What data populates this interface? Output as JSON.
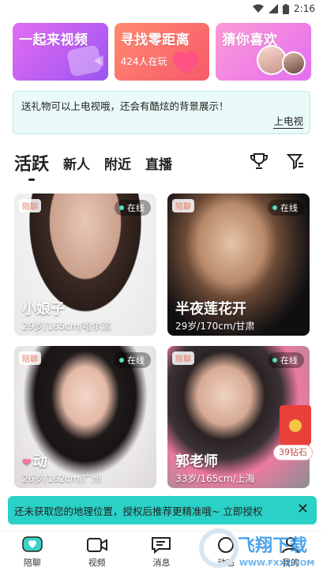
{
  "status": {
    "time": "2:16"
  },
  "promos": [
    {
      "title": "一起来视频",
      "subtitle": ""
    },
    {
      "title": "寻找零距离",
      "subtitle": "424人在玩"
    },
    {
      "title": "猜你喜欢",
      "subtitle": ""
    }
  ],
  "notice": {
    "text": "送礼物可以上电视哦，还会有酷炫的背景展示！",
    "link": "上电视"
  },
  "tabs": [
    "活跃",
    "新人",
    "附近",
    "直播"
  ],
  "cards": [
    {
      "tag": "陪聊",
      "status": "在线",
      "name": "小娘子",
      "info": "29岁/165cm/哈尔滨"
    },
    {
      "tag": "陪聊",
      "status": "在线",
      "name": "半夜莲花开",
      "info": "29岁/170cm/甘肃"
    },
    {
      "tag": "陪聊",
      "status": "在线",
      "name": "动",
      "info": "26岁/162cm/广州"
    },
    {
      "tag": "陪聊",
      "status": "在线",
      "name": "郭老师",
      "info": "33岁/165cm/上海"
    }
  ],
  "gift": {
    "label": "39钻石"
  },
  "banner": {
    "text": "还未获取您的地理位置，授权后推荐更精准哦~ 立即授权"
  },
  "tabbar": [
    {
      "label": "陪聊",
      "icon": "chat-heart-icon"
    },
    {
      "label": "视频",
      "icon": "video-icon"
    },
    {
      "label": "消息",
      "icon": "message-icon"
    },
    {
      "label": "动态",
      "icon": "moments-icon"
    },
    {
      "label": "我的",
      "icon": "profile-icon"
    }
  ],
  "watermark": {
    "brand": "飞翔下载",
    "url": "WWW.FXXZ.COM"
  }
}
